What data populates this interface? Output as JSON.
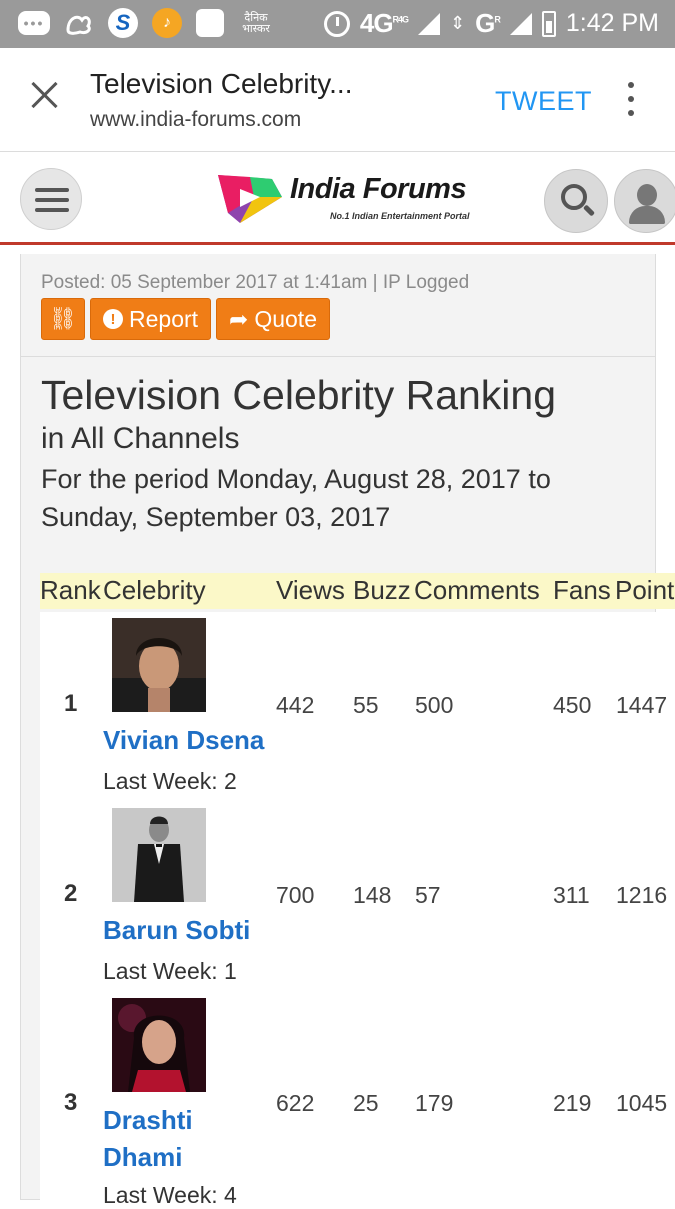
{
  "status_bar": {
    "hindi_app_label": "दैनिक भास्कर",
    "network": "4G",
    "network_small": "R4G",
    "network2": "G",
    "network2_small": "R",
    "time": "1:42 PM"
  },
  "browser": {
    "title": "Television Celebrity...",
    "url": "www.india-forums.com",
    "tweet_label": "TWEET"
  },
  "site": {
    "logo_text": "India Forums",
    "logo_tagline": "No.1 Indian Entertainment Portal"
  },
  "post": {
    "meta": "Posted: 05 September 2017 at 1:41am | IP Logged",
    "report_label": "Report",
    "quote_label": "Quote"
  },
  "ranking": {
    "title": "Television Celebrity Ranking",
    "subtitle": "in All Channels",
    "period": "For the period Monday, August 28, 2017 to Sunday, September 03, 2017",
    "headers": {
      "rank": "Rank",
      "celebrity": "Celebrity",
      "views": "Views",
      "buzz": "Buzz",
      "comments": "Comments",
      "fans": "Fans",
      "points": "Points"
    },
    "rows": [
      {
        "rank": "1",
        "name": "Vivian Dsena",
        "last_week": "Last Week: 2",
        "views": "442",
        "buzz": "55",
        "comments": "500",
        "fans": "450",
        "points": "1447"
      },
      {
        "rank": "2",
        "name": "Barun Sobti",
        "last_week": "Last Week: 1",
        "views": "700",
        "buzz": "148",
        "comments": "57",
        "fans": "311",
        "points": "1216"
      },
      {
        "rank": "3",
        "name": "Drashti Dhami",
        "last_week": "Last Week: 4",
        "views": "622",
        "buzz": "25",
        "comments": "179",
        "fans": "219",
        "points": "1045"
      }
    ]
  },
  "colors": {
    "accent_orange": "#f07d16",
    "link_blue": "#1f6fc5",
    "header_red": "#c0392b",
    "table_header_bg": "#fbf8c8",
    "tweet_blue": "#2196f3"
  },
  "icons": [
    "chat-icon",
    "uc-browser-icon",
    "s-app-icon",
    "guitar-app-icon",
    "app-square-icon",
    "alarm-icon",
    "signal-icon",
    "battery-icon",
    "close-icon",
    "overflow-menu-icon",
    "hamburger-icon",
    "search-icon",
    "user-icon",
    "link-icon",
    "alert-icon",
    "share-arrow-icon"
  ]
}
